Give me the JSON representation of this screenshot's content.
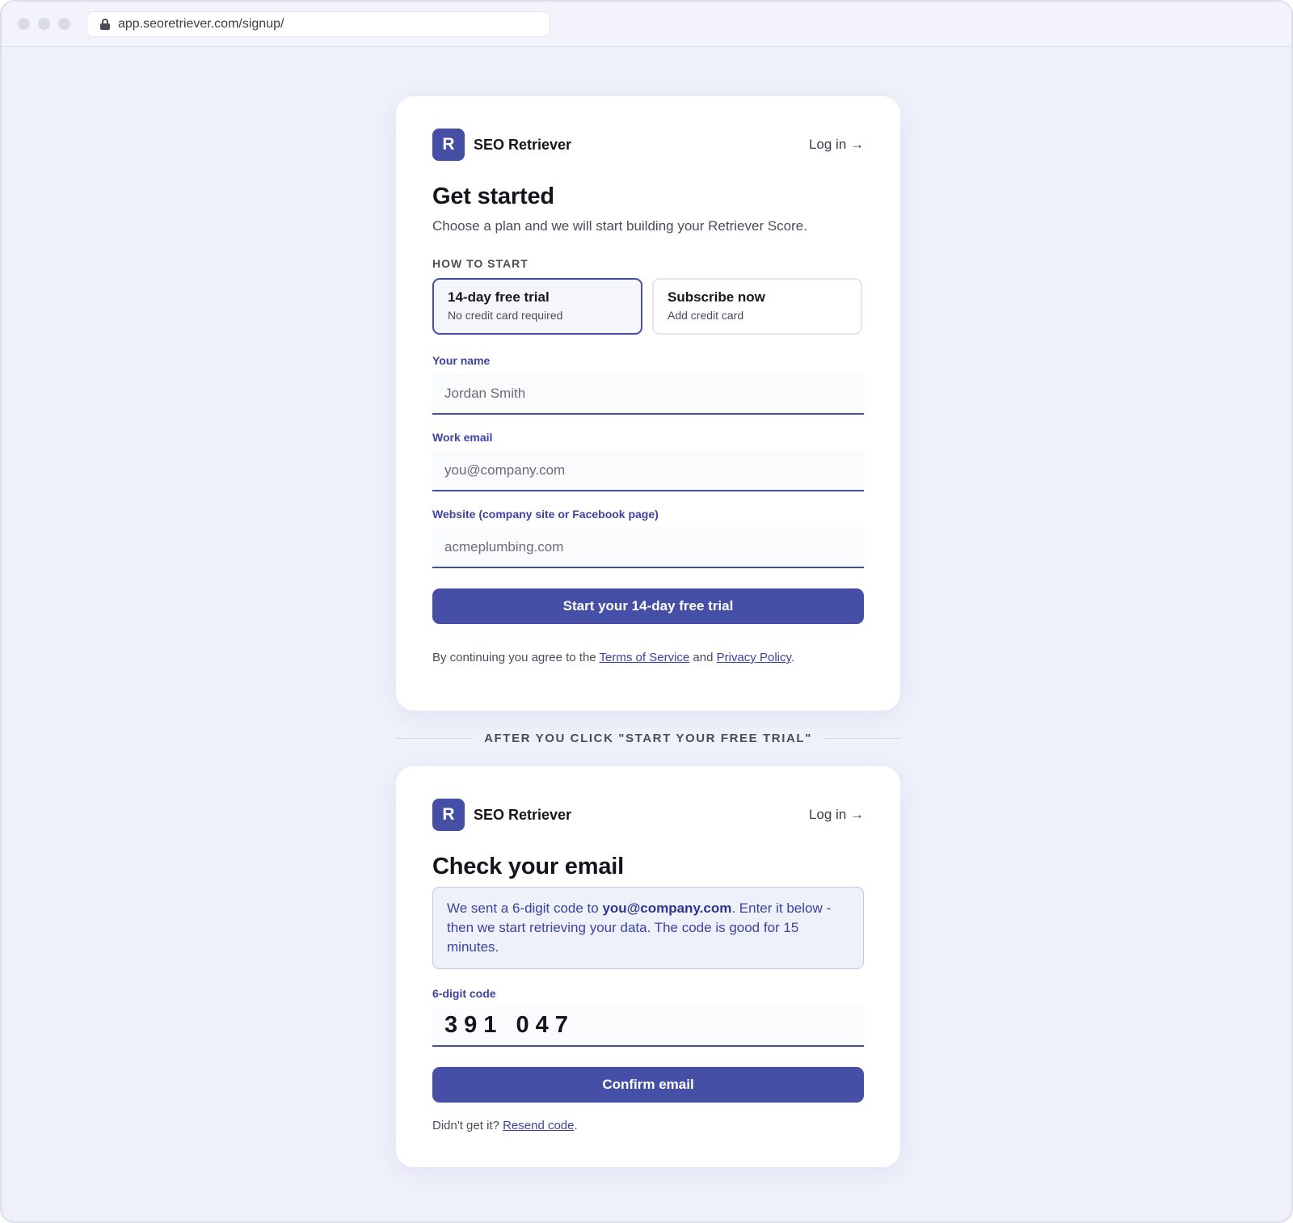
{
  "browser": {
    "url": "app.seoretriever.com/signup/"
  },
  "brand": {
    "logo_letter": "R",
    "name": "SEO Retriever",
    "login_link": "Log in →"
  },
  "signup": {
    "title": "Get started",
    "subtitle": "Choose a plan and we will start building your Retriever Score.",
    "section_label": "HOW TO START",
    "plans": [
      {
        "title": "14-day free trial",
        "subtitle": "No credit card required",
        "selected": true
      },
      {
        "title": "Subscribe now",
        "subtitle": "Add credit card",
        "selected": false
      }
    ],
    "fields": [
      {
        "label": "Your name",
        "placeholder": "Jordan Smith"
      },
      {
        "label": "Work email",
        "placeholder": "you@company.com"
      },
      {
        "label": "Website (company site or Facebook page)",
        "placeholder": "acmeplumbing.com"
      }
    ],
    "submit_label": "Start your 14-day free trial",
    "legal_prefix": "By continuing you agree to the ",
    "terms_link": "Terms of Service",
    "legal_and": " and ",
    "privacy_link": "Privacy Policy",
    "legal_suffix": "."
  },
  "divider": {
    "text": "AFTER YOU CLICK \"START YOUR FREE TRIAL\""
  },
  "verify": {
    "title": "Check your email",
    "notice_prefix": "We sent a 6-digit code to ",
    "notice_email": "you@company.com",
    "notice_suffix": ". Enter it below - then we start retrieving your data. The code is good for 15 minutes.",
    "code_label": "6-digit code",
    "code_value": "391 047",
    "confirm_label": "Confirm email",
    "resend_prefix": "Didn't get it? ",
    "resend_link": "Resend code",
    "resend_suffix": "."
  },
  "colors": {
    "accent": "#454fa5",
    "background": "#eef0fa",
    "label": "#3b44a0"
  }
}
